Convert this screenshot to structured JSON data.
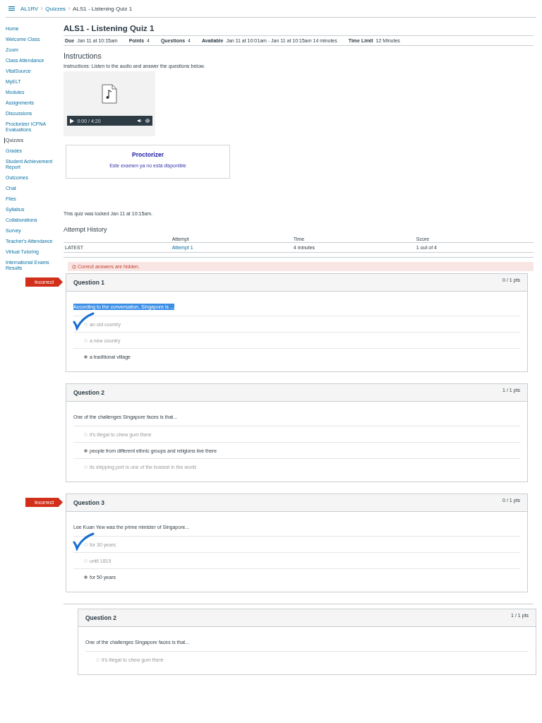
{
  "breadcrumb": [
    {
      "label": "AL1RV",
      "link": true
    },
    {
      "label": "Quizzes",
      "link": true
    },
    {
      "label": "ALS1 - Listening Quiz 1",
      "link": false
    }
  ],
  "sidebar": {
    "items": [
      {
        "label": "Home",
        "selected": false
      },
      {
        "label": "Welcome Class",
        "selected": false
      },
      {
        "label": "Zoom",
        "selected": false
      },
      {
        "label": "Class Attendance",
        "selected": false
      },
      {
        "label": "VitalSource",
        "selected": false
      },
      {
        "label": "MyELT",
        "selected": false
      },
      {
        "label": "Modules",
        "selected": false
      },
      {
        "label": "Assignments",
        "selected": false
      },
      {
        "label": "Discussions",
        "selected": false
      },
      {
        "label": "Proctorizer ICPNA Evaluations",
        "selected": false
      },
      {
        "label": "Quizzes",
        "selected": true
      },
      {
        "label": "Grades",
        "selected": false
      },
      {
        "label": "Student Achievement Report",
        "selected": false
      },
      {
        "label": "Outcomes",
        "selected": false
      },
      {
        "label": "Chat",
        "selected": false
      },
      {
        "label": "Files",
        "selected": false
      },
      {
        "label": "Syllabus",
        "selected": false
      },
      {
        "label": "Collaborations",
        "selected": false
      },
      {
        "label": "Survey",
        "selected": false
      },
      {
        "label": "Teacher's Attendance",
        "selected": false
      },
      {
        "label": "Virtual Tutoring",
        "selected": false
      },
      {
        "label": "International Exams Results",
        "selected": false
      }
    ]
  },
  "quiz": {
    "title": "ALS1 - Listening Quiz 1",
    "meta": [
      {
        "label": "Due",
        "value": "Jan 11 at 10:15am"
      },
      {
        "label": "Points",
        "value": "4"
      },
      {
        "label": "Questions",
        "value": "4"
      },
      {
        "label": "Available",
        "value": "Jan 11 at 10:01am - Jan 11 at 10:15am",
        "note": "14 minutes"
      },
      {
        "label": "Time Limit",
        "value": "12 Minutes"
      }
    ]
  },
  "instructions": {
    "heading": "Instructions",
    "text": "Instructions:  Listen to the audio and answer the questions below."
  },
  "audio": {
    "time": "0:00 / 4:20"
  },
  "proctorizer": {
    "title": "Proctorizer",
    "message": "Este examen ya no está disponible"
  },
  "lock_message": "This quiz was locked Jan 11 at 10:15am.",
  "attempt_history": {
    "heading": "Attempt History",
    "columns": [
      "Attempt",
      "Time",
      "Score"
    ],
    "rows": [
      {
        "label": "LATEST",
        "cells": [
          "Attempt 1",
          "4 minutes",
          "1 out of 4"
        ]
      }
    ]
  },
  "alert": "Correct answers are hidden.",
  "questions": [
    {
      "kind": "card",
      "flag": "Incorrect",
      "title": "Question 1",
      "points": "0 / 1 pts",
      "text": "According to the conversation, Singapore is ...",
      "highlighted": true,
      "answers": [
        {
          "text": "an old country",
          "selected": false,
          "pen_check": true
        },
        {
          "text": "a new country",
          "selected": false,
          "pen_check": false
        },
        {
          "text": "a traditional village",
          "selected": true,
          "pen_check": false
        }
      ]
    },
    {
      "kind": "card",
      "title": "Question 2",
      "points": "1 / 1 pts",
      "text": "One of the challenges Singapore faces is that...",
      "highlighted": false,
      "answers": [
        {
          "text": "it's illegal to chew gum there",
          "selected": false,
          "pen_check": false
        },
        {
          "text": "people from different ethnic groups and religions live there",
          "selected": true,
          "pen_check": false
        },
        {
          "text": "its shipping port is one of the busiest in the world",
          "selected": false,
          "pen_check": false
        }
      ]
    },
    {
      "kind": "card",
      "flag": "Incorrect",
      "title": "Question 3",
      "points": "0 / 1 pts",
      "text": "Lee Kuan Yew was the prime minister of Singapore...",
      "highlighted": false,
      "answers": [
        {
          "text": "for 30 years",
          "selected": false,
          "pen_check": true
        },
        {
          "text": "until 1819",
          "selected": false,
          "pen_check": false
        },
        {
          "text": "for 50 years",
          "selected": true,
          "pen_check": false
        }
      ]
    },
    {
      "kind": "pasted",
      "title": "Question 2",
      "points": "1 / 1 pts",
      "text": "One of the challenges Singapore faces is that...",
      "highlighted": false,
      "answers": [
        {
          "text": "it's illegal to chew gum there",
          "selected": false,
          "pen_check": false
        }
      ]
    }
  ]
}
